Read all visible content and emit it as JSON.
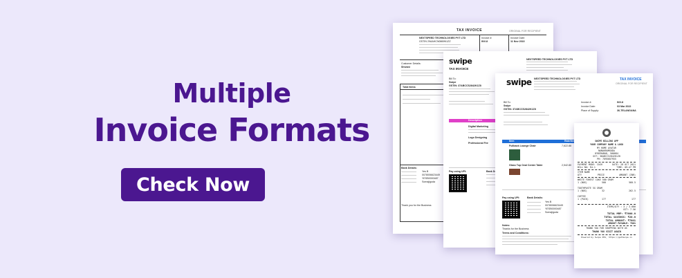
{
  "headline": {
    "line1": "Multiple",
    "line2": "Invoice Formats"
  },
  "cta": {
    "label": "Check Now"
  },
  "colors": {
    "brand": "#4b1790",
    "background": "#ece8fb",
    "accent_pink": "#e040c8",
    "accent_blue": "#1f6fd8"
  },
  "invoice1": {
    "title": "TAX INVOICE",
    "copy": "ORIGINAL FOR RECIPIENT",
    "company": "NEXTSPEED TECHNOLOGIES PVT LTD",
    "gstin": "GSTIN 29AAHCN0869N1ZZ",
    "invoice_label": "Invoice #:",
    "invoice_no": "INV-8",
    "date_label": "Invoice Date:",
    "date": "11 Nov 2022",
    "customer_label": "Customer Details:",
    "customer_name": "Shivani",
    "total_label": "Total Items",
    "bank_label": "Bank Details:",
    "bank_name": "Yes B",
    "account": "0078006623449",
    "ifsc": "YESB0000487",
    "branch": "Somajiguda",
    "notes": "Thank you for the Business"
  },
  "invoice2": {
    "logo": "swipe",
    "title": "TAX INVOICE",
    "company": "NEXTSPEED TECHNOLOGIES PVT LTD",
    "bill_to": "Bill To:",
    "customer": "Swipe",
    "gstin": "GSTIN: 37ABCCS2842K1Z8",
    "col_desc": "Description",
    "item1": "Digital Marketing",
    "item2": "Logo Designing",
    "item3": "Professional Fee",
    "pay_label": "Pay using UPI:",
    "bank_label": "Bank Details:"
  },
  "invoice3": {
    "logo": "swipe",
    "company": "NEXTSPEED TECHNOLOGIES PVT LTD",
    "title": "TAX INVOICE",
    "copy": "ORIGINAL FOR RECIPIENT",
    "invoice_label": "Invoice #:",
    "invoice_no": "INV-8",
    "date_label": "Invoice Date:",
    "date": "03 Mar 2022",
    "place_label": "Place of Supply:",
    "place": "36-TELANGANA",
    "bill_to": "Bill To:",
    "customer": "Swipe",
    "gstin": "GSTIN: 37ABCCS2842K1Z8",
    "col_item": "Item",
    "col_rate": "Rate/Item",
    "item1": "Fullback Lounge Chair",
    "item1_price": "7,622.88",
    "item2": "Glass Top Oval Center Table",
    "item2_price": "2,542.80",
    "pay_label": "Pay using UPI:",
    "bank_label": "Bank Details:",
    "bank_name": "Yes B",
    "account": "0078006623449",
    "ifsc": "YESB0000487",
    "branch": "Somajiguda",
    "notes_label": "Notes:",
    "notes": "Thanks for the Business",
    "terms_label": "Terms and Conditions:"
  },
  "receipt": {
    "shop": "SWIPE BILLING APP",
    "line1": "YOUR COMPANY NAME & LOGO",
    "addr1": "MY HOME AVATAR",
    "addr2": "NANAKRAMGUDA",
    "addr3": "HYDERABAD, 500084",
    "gst": "GST: 36ABCCS2842K1Z8",
    "ph": "PH: 7095607955",
    "pay_mode": "PAYMENT MODE: CASH",
    "date": "DATE: 28 OCT 2021",
    "bill_no": "BILL NO: R4-1",
    "time": "TIME: 09:47 PM",
    "item_name": "ITEM NAME",
    "qty": "QTY",
    "price": "PRICE",
    "amount": "AMOUNT (INR)",
    "item1": "WHITE FOREST CAKE 500 GRAM",
    "item1_qty": "1 (NOS)",
    "item1_price": "500",
    "item1_amt": "560.5",
    "item2": "TOOTHPASTE 5G GRAM",
    "item2_qty": "1 (NOS)",
    "item2_price": "32",
    "item2_amt": "262.5",
    "item3": "COFFEE",
    "item3_qty": "1 (PACK)",
    "item3_price": "177",
    "item3_amt": "177",
    "items_qty": "ITEMS/QTY : 3 / 3.000",
    "gst_line": "GST: 7.56",
    "total_mrp": "TOTAL MRP: ₹7600.0",
    "total_savings": "TOTAL SAVINGS: ₹20.0",
    "total_amount": "TOTAL AMOUNT: ₹7801",
    "amount_payable": "AMOUNT PAYABLE: 7801",
    "thanks1": "THANK YOU FOR SHOPPING WITH US",
    "thanks2": "THANK YOU VISIT AGAIN",
    "footer": "Powered by Swipe POS, https://getSwipe.in"
  }
}
